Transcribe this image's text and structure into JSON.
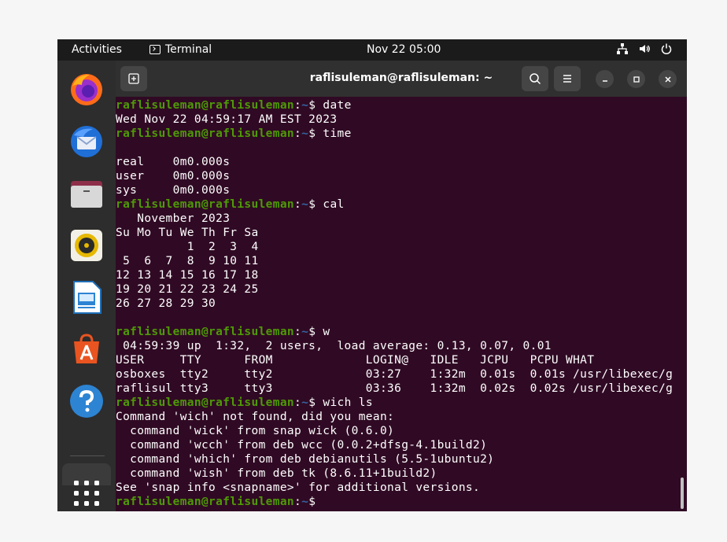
{
  "topbar": {
    "activities": "Activities",
    "app_name": "Terminal",
    "clock": "Nov 22  05:00"
  },
  "dock": {
    "items": [
      "firefox-icon",
      "thunderbird-icon",
      "files-icon",
      "rhythmbox-icon",
      "libreoffice-writer-icon",
      "app-center-icon",
      "help-icon",
      "show-apps-icon"
    ]
  },
  "terminal": {
    "title": "raflisuleman@raflisuleman: ~",
    "prompt": {
      "user_host": "raflisuleman@raflisuleman",
      "colon": ":",
      "path": "~",
      "symbol": "$ "
    },
    "lines": [
      {
        "type": "prompt",
        "cmd": "date"
      },
      {
        "type": "text",
        "text": "Wed Nov 22 04:59:17 AM EST 2023"
      },
      {
        "type": "prompt",
        "cmd": "time"
      },
      {
        "type": "text",
        "text": ""
      },
      {
        "type": "text",
        "text": "real    0m0.000s"
      },
      {
        "type": "text",
        "text": "user    0m0.000s"
      },
      {
        "type": "text",
        "text": "sys     0m0.000s"
      },
      {
        "type": "prompt",
        "cmd": "cal"
      },
      {
        "type": "text",
        "text": "   November 2023"
      },
      {
        "type": "text",
        "text": "Su Mo Tu We Th Fr Sa"
      },
      {
        "type": "text",
        "text": "          1  2  3  4"
      },
      {
        "type": "text",
        "text": " 5  6  7  8  9 10 11"
      },
      {
        "type": "text",
        "text": "12 13 14 15 16 17 18"
      },
      {
        "type": "text",
        "text": "19 20 21 22 23 24 25"
      },
      {
        "type": "text",
        "text": "26 27 28 29 30"
      },
      {
        "type": "text",
        "text": ""
      },
      {
        "type": "prompt",
        "cmd": "w"
      },
      {
        "type": "text",
        "text": " 04:59:39 up  1:32,  2 users,  load average: 0.13, 0.07, 0.01"
      },
      {
        "type": "text",
        "text": "USER     TTY      FROM             LOGIN@   IDLE   JCPU   PCPU WHAT"
      },
      {
        "type": "text",
        "text": "osboxes  tty2     tty2             03:27    1:32m  0.01s  0.01s /usr/libexec/g"
      },
      {
        "type": "text",
        "text": "raflisul tty3     tty3             03:36    1:32m  0.02s  0.02s /usr/libexec/g"
      },
      {
        "type": "prompt",
        "cmd": "wich ls"
      },
      {
        "type": "text",
        "text": "Command 'wich' not found, did you mean:"
      },
      {
        "type": "text",
        "text": "  command 'wick' from snap wick (0.6.0)"
      },
      {
        "type": "text",
        "text": "  command 'wcch' from deb wcc (0.0.2+dfsg-4.1build2)"
      },
      {
        "type": "text",
        "text": "  command 'which' from deb debianutils (5.5-1ubuntu2)"
      },
      {
        "type": "text",
        "text": "  command 'wish' from deb tk (8.6.11+1build2)"
      },
      {
        "type": "text",
        "text": "See 'snap info <snapname>' for additional versions."
      },
      {
        "type": "prompt",
        "cmd": ""
      }
    ]
  },
  "colors": {
    "terminal_bg": "#300a24",
    "prompt_user": "#4e9a06",
    "prompt_path": "#3465a4"
  }
}
